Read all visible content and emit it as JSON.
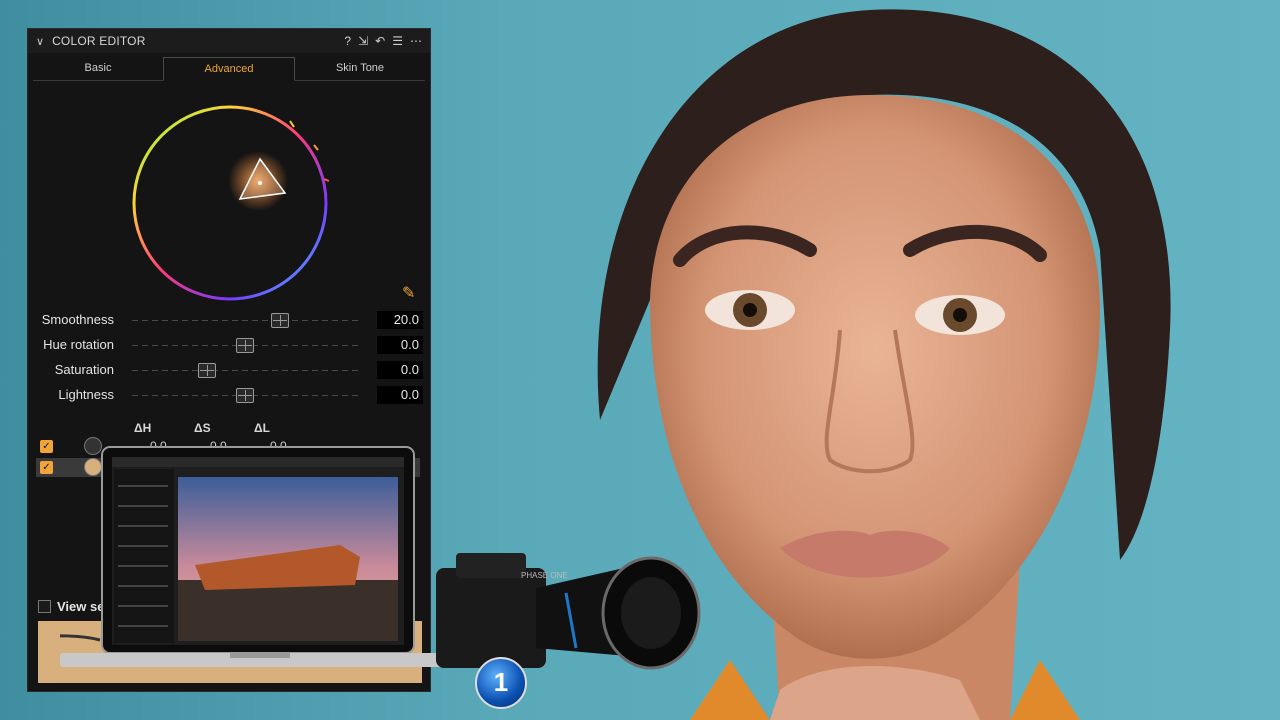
{
  "panel": {
    "title": "COLOR EDITOR",
    "icons": [
      "help-icon",
      "expand-icon",
      "undo-icon",
      "menu-icon",
      "more-icon"
    ],
    "help_glyph": "?",
    "tabs": [
      {
        "label": "Basic",
        "active": false
      },
      {
        "label": "Advanced",
        "active": true
      },
      {
        "label": "Skin Tone",
        "active": false
      }
    ],
    "accent": "#f0a43a"
  },
  "sliders": [
    {
      "label": "Smoothness",
      "value": "20.0",
      "level": 0.65
    },
    {
      "label": "Hue rotation",
      "value": "0.0",
      "level": 0.5
    },
    {
      "label": "Saturation",
      "value": "0.0",
      "level": 0.33
    },
    {
      "label": "Lightness",
      "value": "0.0",
      "level": 0.5
    }
  ],
  "deltas": {
    "headers": [
      "ΔH",
      "ΔS",
      "ΔL"
    ],
    "row1": [
      "0.0",
      "0.0",
      "0.0"
    ]
  },
  "view": {
    "label": "View se"
  },
  "swatch_color": "#d8b07d",
  "laptop": {
    "brand_text": "PHASE ONE"
  },
  "badge": {
    "glyph": "1"
  }
}
